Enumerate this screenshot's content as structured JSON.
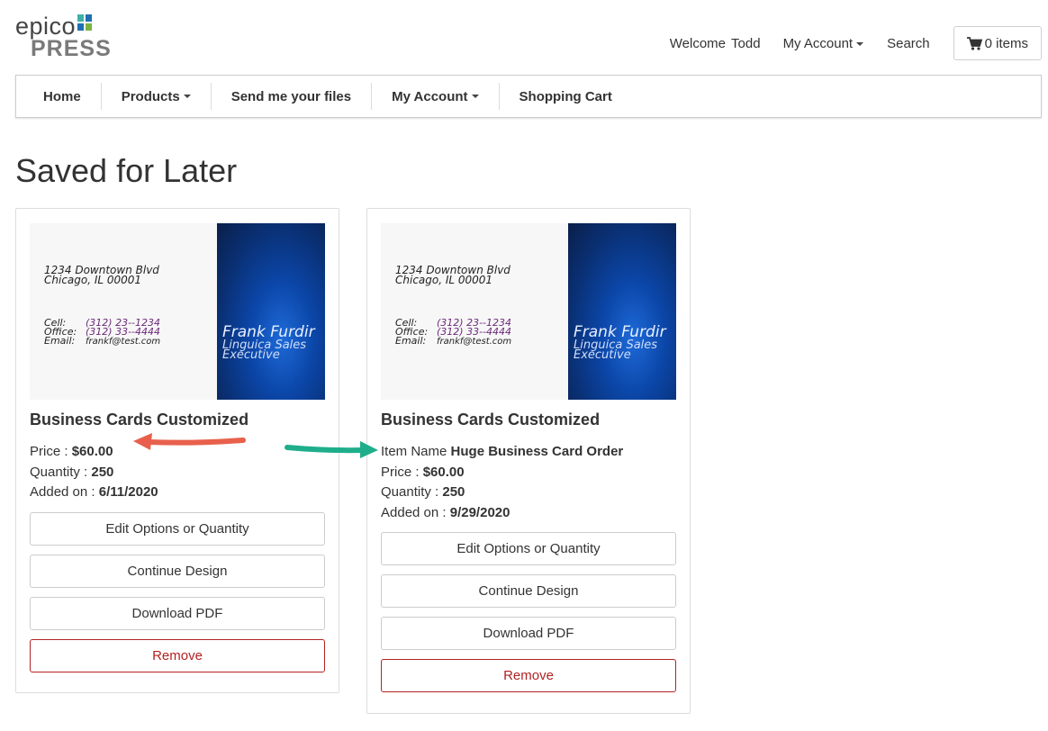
{
  "logo": {
    "line1": "epico",
    "line2": "PRESS"
  },
  "header": {
    "welcome_label": "Welcome",
    "user_name": "Todd",
    "my_account": "My Account",
    "search": "Search",
    "cart": "0 items"
  },
  "nav": {
    "home": "Home",
    "products": "Products",
    "send_files": "Send me your files",
    "my_account": "My Account",
    "shopping_cart": "Shopping Cart"
  },
  "page_title": "Saved for Later",
  "business_card": {
    "address1": "1234 Downtown Blvd",
    "address2": "Chicago, IL 00001",
    "cell_label": "Cell:",
    "cell_value": "(312) 23--1234",
    "office_label": "Office:",
    "office_value": "(312) 33--4444",
    "email_label": "Email:",
    "email_value": "frankf@test.com",
    "name": "Frank Furdir",
    "title_line1": "Linguica Sales",
    "title_line2": "Executive"
  },
  "labels": {
    "item_name": "Item Name",
    "price": "Price :",
    "quantity": "Quantity :",
    "added_on": "Added on :",
    "edit": "Edit Options or Quantity",
    "continue": "Continue Design",
    "download": "Download PDF",
    "remove": "Remove"
  },
  "items": [
    {
      "product_name": "Business Cards Customized",
      "price": "$60.00",
      "quantity": "250",
      "added_on": "6/11/2020"
    },
    {
      "product_name": "Business Cards Customized",
      "item_name": "Huge Business Card Order",
      "price": "$60.00",
      "quantity": "250",
      "added_on": "9/29/2020"
    }
  ],
  "colors": {
    "remove": "#b22222",
    "arrow_red": "#e8604c",
    "arrow_green": "#1fae8c",
    "logo_blue": "#1f6fb2",
    "logo_teal": "#3fb0a8",
    "logo_green": "#7cb342"
  }
}
